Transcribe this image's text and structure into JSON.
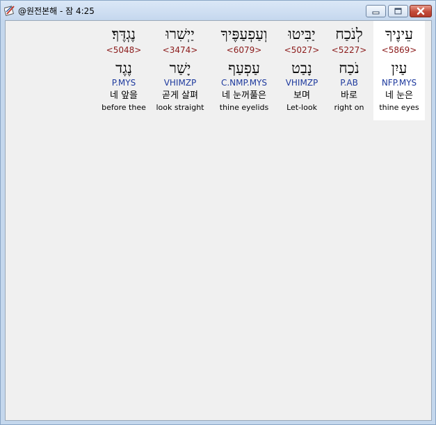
{
  "window": {
    "title": "@원전본해 - 잠 4:25"
  },
  "columns": [
    {
      "hebrew": "עֵינֶיךָ",
      "strong": "<5869>",
      "lemma": "עַיִן",
      "morph": "NFP.MYS",
      "korean": "네 눈은",
      "english": "thine eyes",
      "selected": true
    },
    {
      "hebrew": "לְנֹכַח",
      "strong": "<5227>",
      "lemma": "נֹכַח",
      "morph": "P.AB",
      "korean": "바로",
      "english": "right on",
      "selected": false
    },
    {
      "hebrew": "יַבִּיטוּ",
      "strong": "<5027>",
      "lemma": "נָבַט",
      "morph": "VHIMZP",
      "korean": "보며",
      "english": "Let-look",
      "selected": false
    },
    {
      "hebrew": "וְעַפְעַפֶּיךָ",
      "strong": "<6079>",
      "lemma": "עַפְעַף",
      "morph": "C.NMP.MYS",
      "korean": "네 눈꺼풀은",
      "english": "thine eyelids",
      "selected": false
    },
    {
      "hebrew": "יַיְשִׁרוּ",
      "strong": "<3474>",
      "lemma": "יָשַׁר",
      "morph": "VHIMZP",
      "korean": "곧게 살펴",
      "english": "look straight",
      "selected": false
    },
    {
      "hebrew": "נֶגְדֶּךָ׃",
      "strong": "<5048>",
      "lemma": "נֶגֶד",
      "morph": "P.MYS",
      "korean": "네 앞을",
      "english": "before thee",
      "selected": false
    }
  ]
}
